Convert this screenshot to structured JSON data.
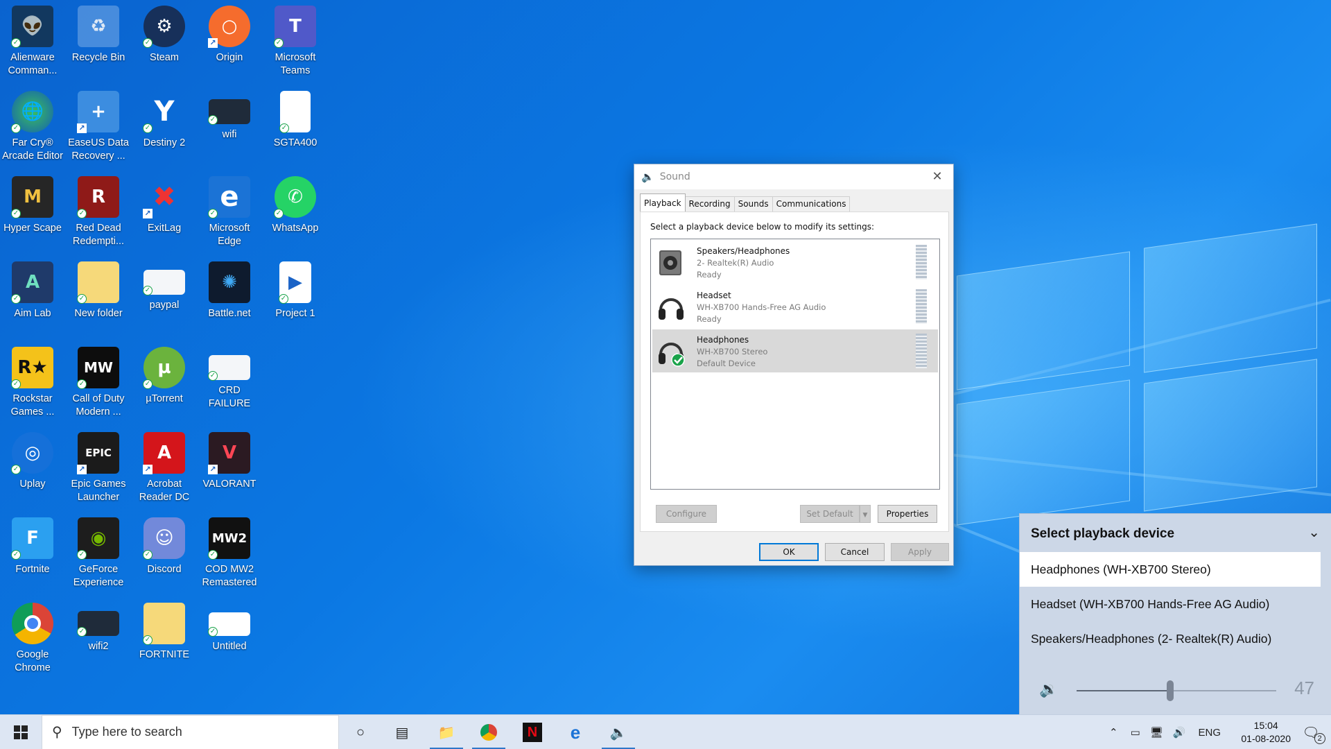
{
  "desktop": {
    "icons": [
      {
        "label": "Alienware Comman..."
      },
      {
        "label": "Recycle Bin"
      },
      {
        "label": "Steam"
      },
      {
        "label": "Origin"
      },
      {
        "label": "Microsoft Teams"
      },
      {
        "label": "Far Cry® Arcade Editor"
      },
      {
        "label": "EaseUS Data Recovery ..."
      },
      {
        "label": "Destiny 2"
      },
      {
        "label": "wifi"
      },
      {
        "label": "SGTA400"
      },
      {
        "label": "Hyper Scape"
      },
      {
        "label": "Red Dead Redempti..."
      },
      {
        "label": "ExitLag"
      },
      {
        "label": "Microsoft Edge"
      },
      {
        "label": "WhatsApp"
      },
      {
        "label": "Aim Lab"
      },
      {
        "label": "New folder"
      },
      {
        "label": "paypal"
      },
      {
        "label": "Battle.net"
      },
      {
        "label": "Project 1"
      },
      {
        "label": "Rockstar Games ..."
      },
      {
        "label": "Call of Duty Modern ..."
      },
      {
        "label": "µTorrent"
      },
      {
        "label": "CRD FAILURE"
      },
      {
        "label": "Uplay"
      },
      {
        "label": "Epic Games Launcher"
      },
      {
        "label": "Acrobat Reader DC"
      },
      {
        "label": "VALORANT"
      },
      {
        "label": "Fortnite"
      },
      {
        "label": "GeForce Experience"
      },
      {
        "label": "Discord"
      },
      {
        "label": "COD MW2 Remastered"
      },
      {
        "label": "Google Chrome"
      },
      {
        "label": "wifi2"
      },
      {
        "label": "FORTNITE"
      },
      {
        "label": "Untitled"
      }
    ]
  },
  "sound_dialog": {
    "title": "Sound",
    "tabs": [
      "Playback",
      "Recording",
      "Sounds",
      "Communications"
    ],
    "active_tab": "Playback",
    "instruction": "Select a playback device below to modify its settings:",
    "devices": [
      {
        "name": "Speakers/Headphones",
        "driver": "2- Realtek(R) Audio",
        "status": "Ready"
      },
      {
        "name": "Headset",
        "driver": "WH-XB700 Hands-Free AG Audio",
        "status": "Ready"
      },
      {
        "name": "Headphones",
        "driver": "WH-XB700 Stereo",
        "status": "Default Device"
      }
    ],
    "buttons": {
      "configure": "Configure",
      "set_default": "Set Default",
      "properties": "Properties",
      "ok": "OK",
      "cancel": "Cancel",
      "apply": "Apply"
    }
  },
  "flyout": {
    "header": "Select playback device",
    "items": [
      "Headphones (WH-XB700 Stereo)",
      "Headset (WH-XB700 Hands-Free AG Audio)",
      "Speakers/Headphones (2- Realtek(R) Audio)"
    ],
    "volume": "47",
    "volume_fraction": 0.47
  },
  "taskbar": {
    "search_placeholder": "Type here to search",
    "lang": "ENG",
    "time": "15:04",
    "date": "01-08-2020",
    "notifications": "2"
  }
}
